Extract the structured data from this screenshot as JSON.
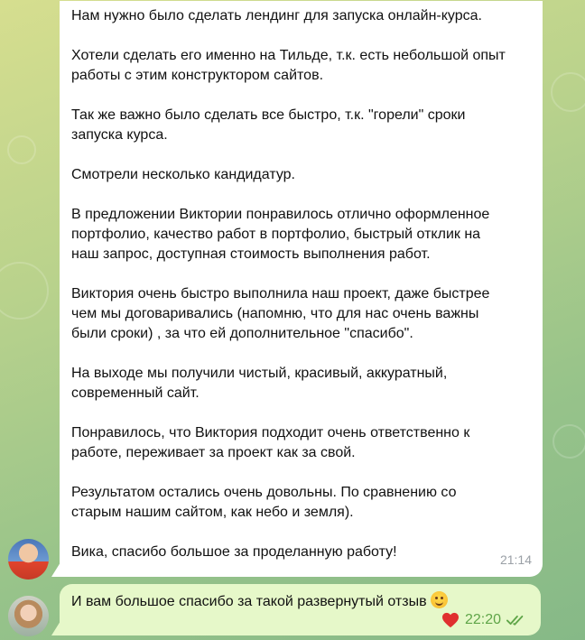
{
  "chat": {
    "messages": [
      {
        "paragraphs": [
          "Нам нужно было сделать лендинг для запуска онлайн-курса.",
          "Хотели сделать его именно на Тильде, т.к. есть небольшой опыт\nработы с этим конструктором сайтов.",
          "Так же важно было сделать все быстро, т.к. \"горели\" сроки\nзапуска курса.",
          "Смотрели несколько кандидатур.",
          "В предложении Виктории понравилось отлично оформленное\nпортфолио, качество работ в портфолио, быстрый отклик на\nнаш запрос, доступная стоимость выполнения работ.",
          "Виктория очень быстро выполнила наш проект, даже быстрее\nчем мы договаривались (напомню, что для нас очень важны\nбыли сроки) , за что ей дополнительное \"спасибо\".",
          "На выходе мы получили чистый, красивый, аккуратный,\nсовременный сайт.",
          "Понравилось, что Виктория подходит очень ответственно к\nработе, переживает за проект как за свой.",
          "Результатом остались очень довольны. По сравнению со\nстарым нашим сайтом, как небо и земля).",
          "Вика, спасибо большое за проделанную работу!"
        ],
        "time": "21:14"
      },
      {
        "text": "И вам большое спасибо за такой развернутый отзыв",
        "emoji": "smiling-face-emoji",
        "reaction": "heart",
        "time": "22:20",
        "status": "read-double-check"
      }
    ]
  },
  "colors": {
    "incoming_bubble": "#ffffff",
    "outgoing_bubble": "#e6f8c9",
    "accent_green": "#5fa548",
    "heart": "#e0302f"
  }
}
